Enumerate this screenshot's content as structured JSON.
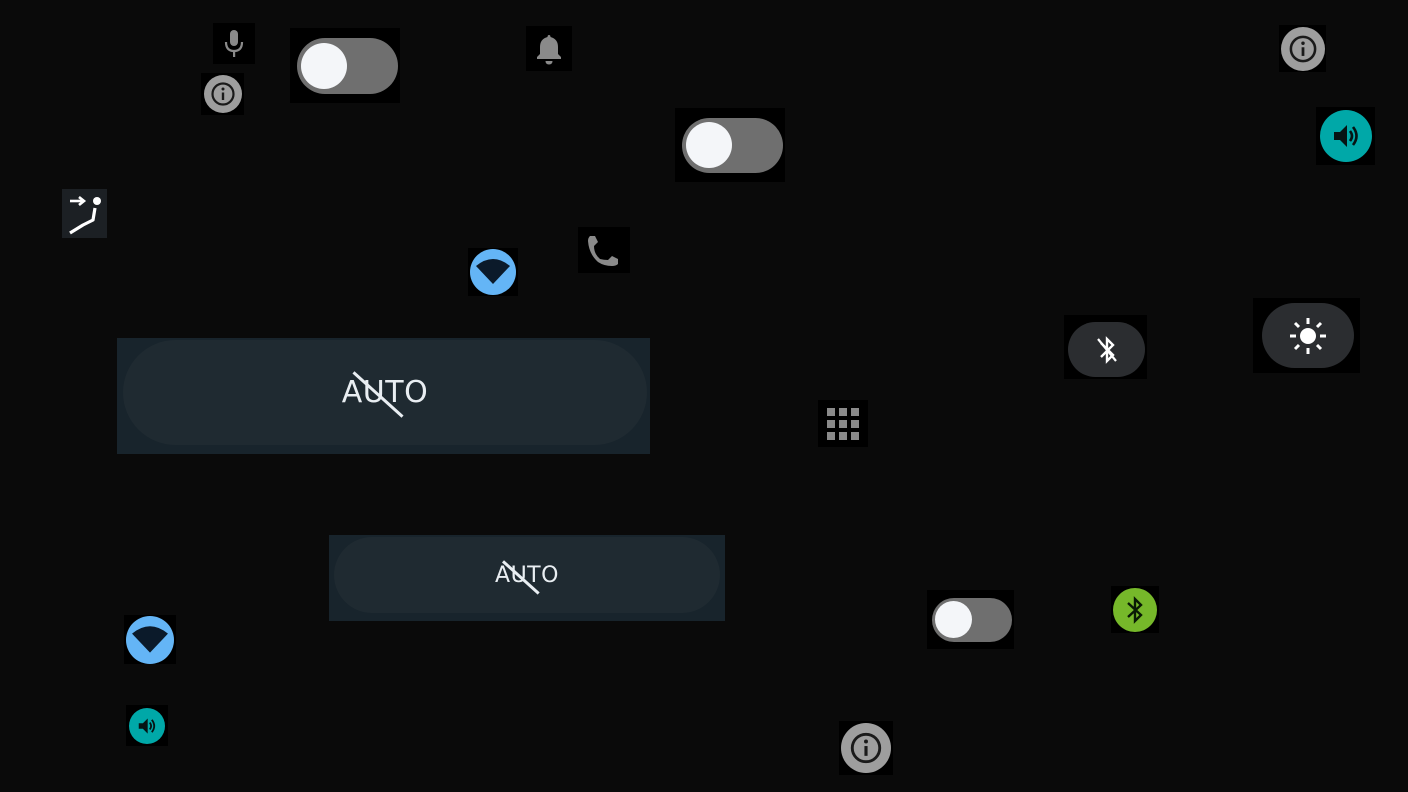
{
  "colors": {
    "background": "#0a0a0a",
    "toggle_track": "#6f6f6f",
    "toggle_knob": "#f4f6f9",
    "info_gray": "#9e9e9e",
    "wifi_blue": "#64b5f6",
    "volume_teal": "#00a8a8",
    "bluetooth_green": "#76b82a",
    "auto_pill": "#1f2a31"
  },
  "icons": {
    "mic": "mic-icon",
    "bell": "bell-icon",
    "info": "info-icon",
    "volume": "volume-icon",
    "seat": "seat-recline-icon",
    "wifi": "wifi-icon",
    "phone": "phone-icon",
    "bluetooth": "bluetooth-icon",
    "brightness": "brightness-icon",
    "apps": "apps-grid-icon"
  },
  "toggles": [
    {
      "id": "toggle-1",
      "state": "off"
    },
    {
      "id": "toggle-2",
      "state": "off"
    },
    {
      "id": "toggle-3",
      "state": "off"
    }
  ],
  "auto_buttons": {
    "large_label": "AUTO",
    "small_label": "AUTO"
  }
}
